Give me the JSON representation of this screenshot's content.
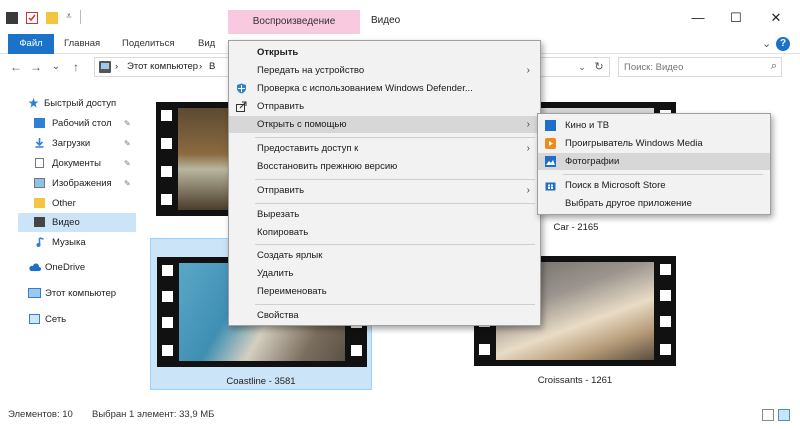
{
  "titlebar": {
    "context_tab": "Воспроизведение",
    "title": "Видео",
    "minimize": "—",
    "maximize": "☐",
    "close": "✕"
  },
  "ribbon": {
    "file": "Файл",
    "home": "Главная",
    "share": "Поделиться",
    "view": "Вид",
    "expand": "⌄",
    "help": "?"
  },
  "nav": {
    "back": "←",
    "forward": "→",
    "recent": "⌄",
    "up": "↑",
    "crumb_root": "›",
    "crumb_pc": "Этот компьютер",
    "crumb_sep": "›",
    "crumb_videos": "В",
    "dropdown": "⌄",
    "refresh": "↻",
    "search_placeholder": "Поиск: Видео",
    "search_icon": "⌕"
  },
  "sidebar": {
    "items": [
      {
        "label": "Быстрый доступ",
        "icon": "star-icon",
        "pinned": false
      },
      {
        "label": "Рабочий стол",
        "icon": "desktop-icon",
        "pinned": true
      },
      {
        "label": "Загрузки",
        "icon": "download-icon",
        "pinned": true
      },
      {
        "label": "Документы",
        "icon": "documents-icon",
        "pinned": true
      },
      {
        "label": "Изображения",
        "icon": "pictures-icon",
        "pinned": true
      },
      {
        "label": "Other",
        "icon": "folder-icon",
        "pinned": false
      },
      {
        "label": "Видео",
        "icon": "video-folder-icon",
        "pinned": false
      },
      {
        "label": "Музыка",
        "icon": "music-icon",
        "pinned": false
      },
      {
        "label": "OneDrive",
        "icon": "cloud-icon",
        "pinned": false
      },
      {
        "label": "Этот компьютер",
        "icon": "computer-icon",
        "pinned": false
      },
      {
        "label": "Сеть",
        "icon": "network-icon",
        "pinned": false
      }
    ],
    "pin_glyph": "📌"
  },
  "files": [
    {
      "caption": "Car - 2165"
    },
    {
      "caption": "Coastline - 3581"
    },
    {
      "caption": "Croissants - 1261"
    }
  ],
  "context_menu": {
    "items": [
      {
        "label": "Открыть",
        "bold": true
      },
      {
        "label": "Передать на устройство",
        "submenu": true
      },
      {
        "label": "Проверка с использованием Windows Defender...",
        "icon": "defender-icon"
      },
      {
        "label": "Отправить",
        "icon": "share-icon"
      },
      {
        "label": "Открыть с помощью",
        "submenu": true,
        "highlighted": true
      },
      {
        "label": "Предоставить доступ к",
        "submenu": true
      },
      {
        "label": "Восстановить прежнюю версию"
      },
      {
        "label": "Отправить",
        "submenu": true
      },
      {
        "label": "Вырезать"
      },
      {
        "label": "Копировать"
      },
      {
        "label": "Создать ярлык"
      },
      {
        "label": "Удалить"
      },
      {
        "label": "Переименовать"
      },
      {
        "label": "Свойства"
      }
    ],
    "arrow": "›"
  },
  "open_with_menu": {
    "items": [
      {
        "label": "Кино и ТВ",
        "icon": "movies-tv-icon"
      },
      {
        "label": "Проигрыватель Windows Media",
        "icon": "media-player-icon"
      },
      {
        "label": "Фотографии",
        "icon": "photos-icon",
        "highlighted": true
      },
      {
        "label": "Поиск в Microsoft Store",
        "icon": "store-icon"
      },
      {
        "label": "Выбрать другое приложение"
      }
    ]
  },
  "status": {
    "count": "Элементов: 10",
    "selection": "Выбран 1 элемент: 33,9 МБ"
  }
}
